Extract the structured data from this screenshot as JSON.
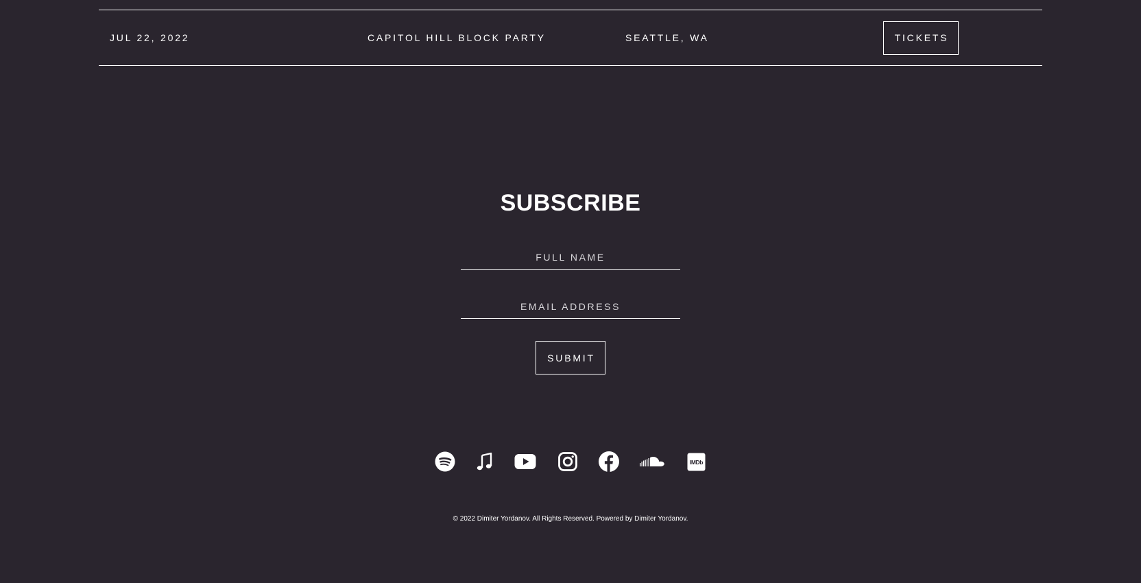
{
  "event": {
    "date": "JUL 22, 2022",
    "name": "CAPITOL HILL BLOCK PARTY",
    "location": "SEATTLE, WA",
    "tickets_label": "TICKETS"
  },
  "subscribe": {
    "title": "SUBSCRIBE",
    "name_placeholder": "FULL NAME",
    "email_placeholder": "EMAIL ADDRESS",
    "submit_label": "SUBMIT"
  },
  "social": {
    "icons": [
      "spotify-icon",
      "music-note-icon",
      "youtube-icon",
      "instagram-icon",
      "facebook-icon",
      "soundcloud-icon",
      "imdb-icon"
    ],
    "imdb_text": "IMDb"
  },
  "footer": {
    "copyright": "© 2022 Dimiter Yordanov. All Rights Reserved. Powered by Dimiter Yordanov."
  },
  "colors": {
    "background": "#2a252e",
    "foreground": "#ffffff"
  }
}
